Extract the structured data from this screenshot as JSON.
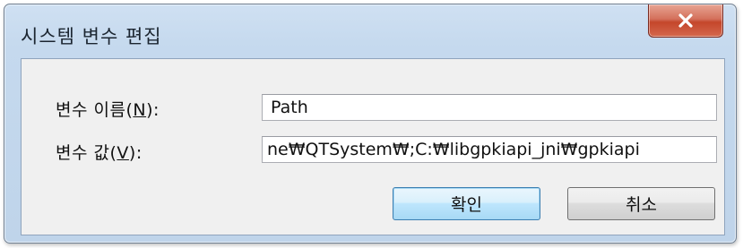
{
  "dialog": {
    "title": "시스템 변수 편집",
    "close_icon": "close-x-icon",
    "close_color": "#c4462b"
  },
  "fields": {
    "name_label_prefix": "변수 이름(",
    "name_label_accel": "N",
    "name_label_suffix": "):",
    "name_value": "Path",
    "value_label_prefix": "변수 값(",
    "value_label_accel": "V",
    "value_label_suffix": "):",
    "value_value": "ne₩QTSystem₩;C:₩libgpkiapi_jni₩gpkiapi"
  },
  "buttons": {
    "ok_label": "확인",
    "cancel_label": "취소"
  }
}
